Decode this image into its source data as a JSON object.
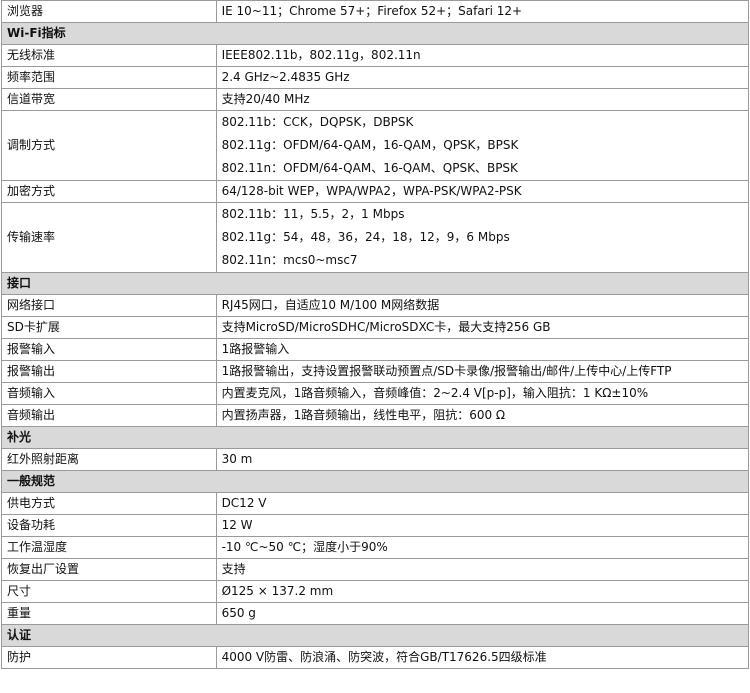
{
  "rows": [
    {
      "type": "row",
      "key": "浏览器",
      "values": [
        "IE 10~11；Chrome 57+；Firefox 52+；Safari 12+"
      ]
    },
    {
      "type": "section",
      "title": "Wi-Fi指标"
    },
    {
      "type": "row",
      "key": "无线标准",
      "values": [
        "IEEE802.11b，802.11g，802.11n"
      ]
    },
    {
      "type": "row",
      "key": "频率范围",
      "values": [
        "2.4 GHz~2.4835 GHz"
      ]
    },
    {
      "type": "row",
      "key": "信道带宽",
      "values": [
        "支持20/40 MHz"
      ]
    },
    {
      "type": "row",
      "key": "调制方式",
      "values": [
        "802.11b：CCK，DQPSK，DBPSK",
        "802.11g：OFDM/64-QAM，16-QAM，QPSK，BPSK",
        "802.11n：OFDM/64-QAM、16-QAM、QPSK、BPSK"
      ]
    },
    {
      "type": "row",
      "key": "加密方式",
      "values": [
        "64/128-bit WEP，WPA/WPA2，WPA-PSK/WPA2-PSK"
      ]
    },
    {
      "type": "row",
      "key": "传输速率",
      "values": [
        "802.11b：11，5.5，2，1 Mbps",
        "802.11g：54，48，36，24，18，12，9，6 Mbps",
        "802.11n：mcs0~msc7"
      ]
    },
    {
      "type": "section",
      "title": "接口"
    },
    {
      "type": "row",
      "key": "网络接口",
      "values": [
        "RJ45网口，自适应10 M/100 M网络数据"
      ]
    },
    {
      "type": "row",
      "key": "SD卡扩展",
      "values": [
        "支持MicroSD/MicroSDHC/MicroSDXC卡，最大支持256 GB"
      ]
    },
    {
      "type": "row",
      "key": "报警输入",
      "values": [
        "1路报警输入"
      ]
    },
    {
      "type": "row",
      "key": "报警输出",
      "values": [
        "1路报警输出，支持设置报警联动预置点/SD卡录像/报警输出/邮件/上传中心/上传FTP"
      ]
    },
    {
      "type": "row",
      "key": "音频输入",
      "values": [
        "内置麦克风，1路音频输入，音频峰值：2~2.4 V[p-p]，输入阻抗：1 KΩ±10%"
      ]
    },
    {
      "type": "row",
      "key": "音频输出",
      "values": [
        "内置扬声器，1路音频输出，线性电平，阻抗：600 Ω"
      ]
    },
    {
      "type": "section",
      "title": "补光"
    },
    {
      "type": "row",
      "key": "红外照射距离",
      "values": [
        "30 m"
      ]
    },
    {
      "type": "section",
      "title": "一般规范"
    },
    {
      "type": "row",
      "key": "供电方式",
      "values": [
        "DC12 V"
      ]
    },
    {
      "type": "row",
      "key": "设备功耗",
      "values": [
        "12 W"
      ]
    },
    {
      "type": "row",
      "key": "工作温湿度",
      "values": [
        "-10 ℃~50 ℃；湿度小于90%"
      ]
    },
    {
      "type": "row",
      "key": "恢复出厂设置",
      "values": [
        "支持"
      ]
    },
    {
      "type": "row",
      "key": "尺寸",
      "values": [
        "Ø125 × 137.2 mm"
      ]
    },
    {
      "type": "row",
      "key": "重量",
      "values": [
        "650 g"
      ]
    },
    {
      "type": "section",
      "title": "认证"
    },
    {
      "type": "row",
      "key": "防护",
      "values": [
        "4000 V防雷、防浪涌、防突波，符合GB/T17626.5四级标准"
      ]
    }
  ]
}
